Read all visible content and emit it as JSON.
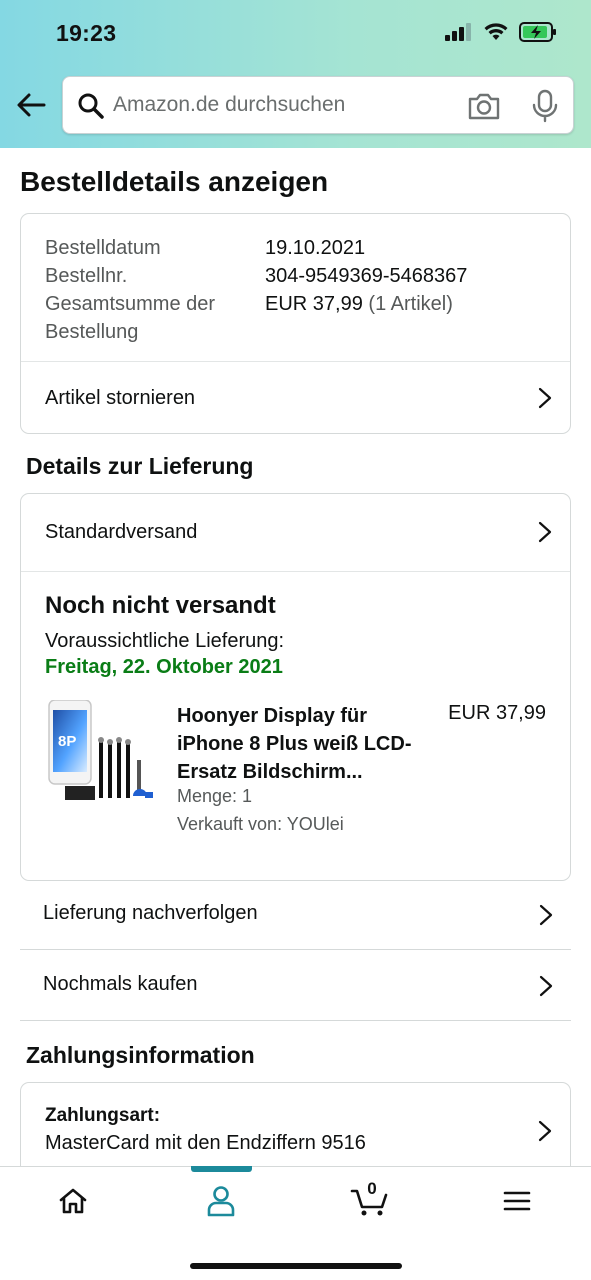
{
  "status_bar": {
    "time": "19:23"
  },
  "search": {
    "placeholder": "Amazon.de durchsuchen"
  },
  "page_title": "Bestelldetails anzeigen",
  "order": {
    "date_label": "Bestelldatum",
    "date_value": "19.10.2021",
    "number_label": "Bestellnr.",
    "number_value": "304-9549369-5468367",
    "total_label": "Gesamtsumme der Bestellung",
    "total_value": "EUR 37,99",
    "total_items": "(1 Artikel)",
    "cancel_label": "Artikel stornieren"
  },
  "delivery": {
    "section_title": "Details zur Lieferung",
    "shipping_method": "Standardversand",
    "status_title": "Noch nicht versandt",
    "expected_label": "Voraussichtliche Lieferung:",
    "expected_date": "Freitag, 22. Oktober 2021",
    "product": {
      "name": "Hoonyer Display für iPhone 8 Plus weiß LCD-Ersatz Bildschirm...",
      "price": "EUR 37,99",
      "quantity": "Menge: 1",
      "seller": "Verkauft von: YOUlei",
      "image_badge": "8P"
    }
  },
  "actions": {
    "track": "Lieferung nachverfolgen",
    "buy_again": "Nochmals kaufen"
  },
  "payment": {
    "section_title": "Zahlungsinformation",
    "method_label": "Zahlungsart:",
    "method_value": "MasterCard mit den Endziffern 9516"
  },
  "bottom_nav": {
    "cart_count": "0",
    "active_color": "#1c8a9b"
  },
  "colors": {
    "delivery_green": "#0a7d16",
    "accent_teal": "#1c8a9b",
    "header_gradient_start": "#84d8e3",
    "header_gradient_end": "#aee7cc"
  },
  "icons": [
    "back-arrow-icon",
    "search-icon",
    "camera-icon",
    "microphone-icon",
    "chevron-right-icon",
    "home-icon",
    "user-icon",
    "cart-icon",
    "menu-icon",
    "signal-icon",
    "wifi-icon",
    "battery-charging-icon"
  ]
}
